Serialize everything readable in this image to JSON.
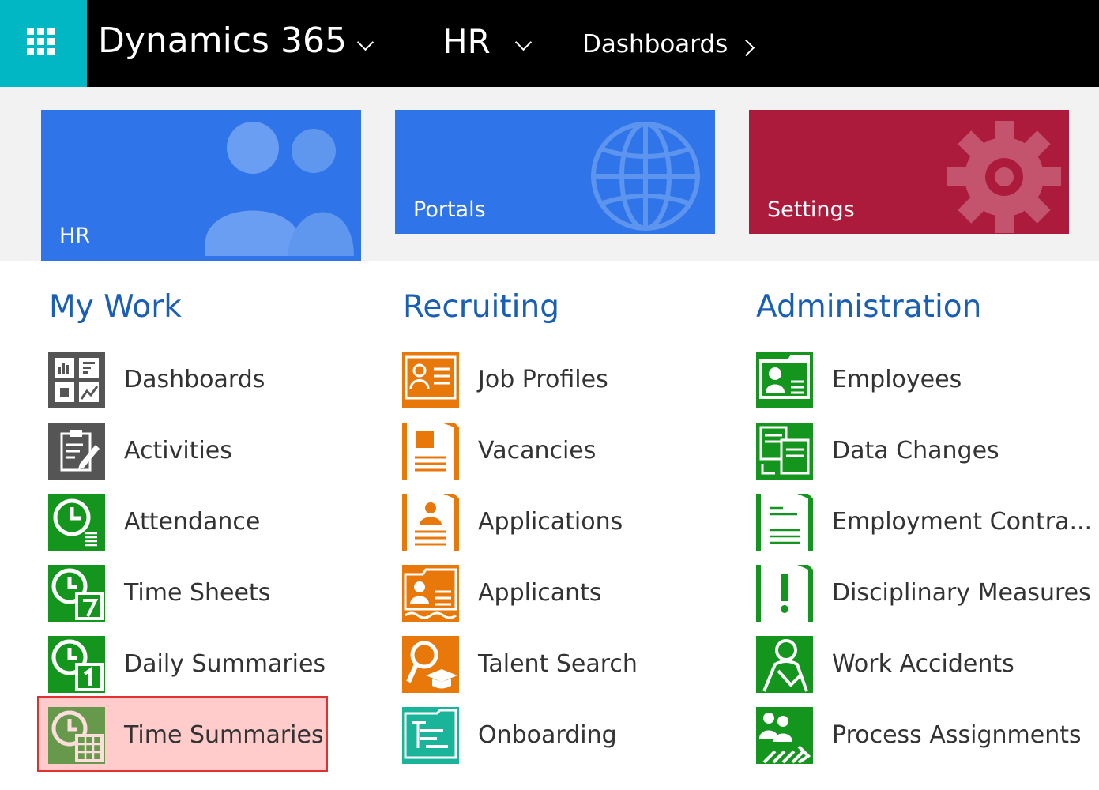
{
  "header": {
    "app_name": "Dynamics 365",
    "module": "HR",
    "breadcrumb": "Dashboards"
  },
  "tiles": [
    {
      "label": "HR",
      "color": "#2f74e8",
      "icon": "people-icon"
    },
    {
      "label": "Portals",
      "color": "#2f74e8",
      "icon": "globe-icon"
    },
    {
      "label": "Settings",
      "color": "#ac1b3c",
      "icon": "gear-icon"
    }
  ],
  "sections": [
    {
      "title": "My Work",
      "items": [
        {
          "label": "Dashboards",
          "icon": "dashboard-icon"
        },
        {
          "label": "Activities",
          "icon": "activities-icon"
        },
        {
          "label": "Attendance",
          "icon": "attendance-icon"
        },
        {
          "label": "Time Sheets",
          "icon": "time-sheet-icon"
        },
        {
          "label": "Daily Summaries",
          "icon": "daily-summary-icon"
        },
        {
          "label": "Time Summaries",
          "icon": "time-summary-icon"
        }
      ]
    },
    {
      "title": "Recruiting",
      "items": [
        {
          "label": "Job Profiles",
          "icon": "job-profile-icon"
        },
        {
          "label": "Vacancies",
          "icon": "vacancy-icon"
        },
        {
          "label": "Applications",
          "icon": "application-icon"
        },
        {
          "label": "Applicants",
          "icon": "applicant-icon"
        },
        {
          "label": "Talent Search",
          "icon": "talent-search-icon"
        },
        {
          "label": "Onboarding",
          "icon": "onboarding-icon"
        }
      ]
    },
    {
      "title": "Administration",
      "items": [
        {
          "label": "Employees",
          "icon": "employee-icon"
        },
        {
          "label": "Data Changes",
          "icon": "data-change-icon"
        },
        {
          "label": "Employment Contra...",
          "icon": "contract-icon"
        },
        {
          "label": "Disciplinary Measures",
          "icon": "disciplinary-icon"
        },
        {
          "label": "Work Accidents",
          "icon": "work-accident-icon"
        },
        {
          "label": "Process Assignments",
          "icon": "process-assignment-icon"
        }
      ]
    }
  ],
  "colors": {
    "waffle": "#00b7c3",
    "section_title": "#1a5fb4",
    "mywork_gray": "#555555",
    "mywork_green": "#14961e",
    "recruiting_orange": "#e8780a",
    "onboarding_teal": "#1ab49b",
    "admin_green": "#14961e",
    "highlight_border": "#e03030"
  }
}
